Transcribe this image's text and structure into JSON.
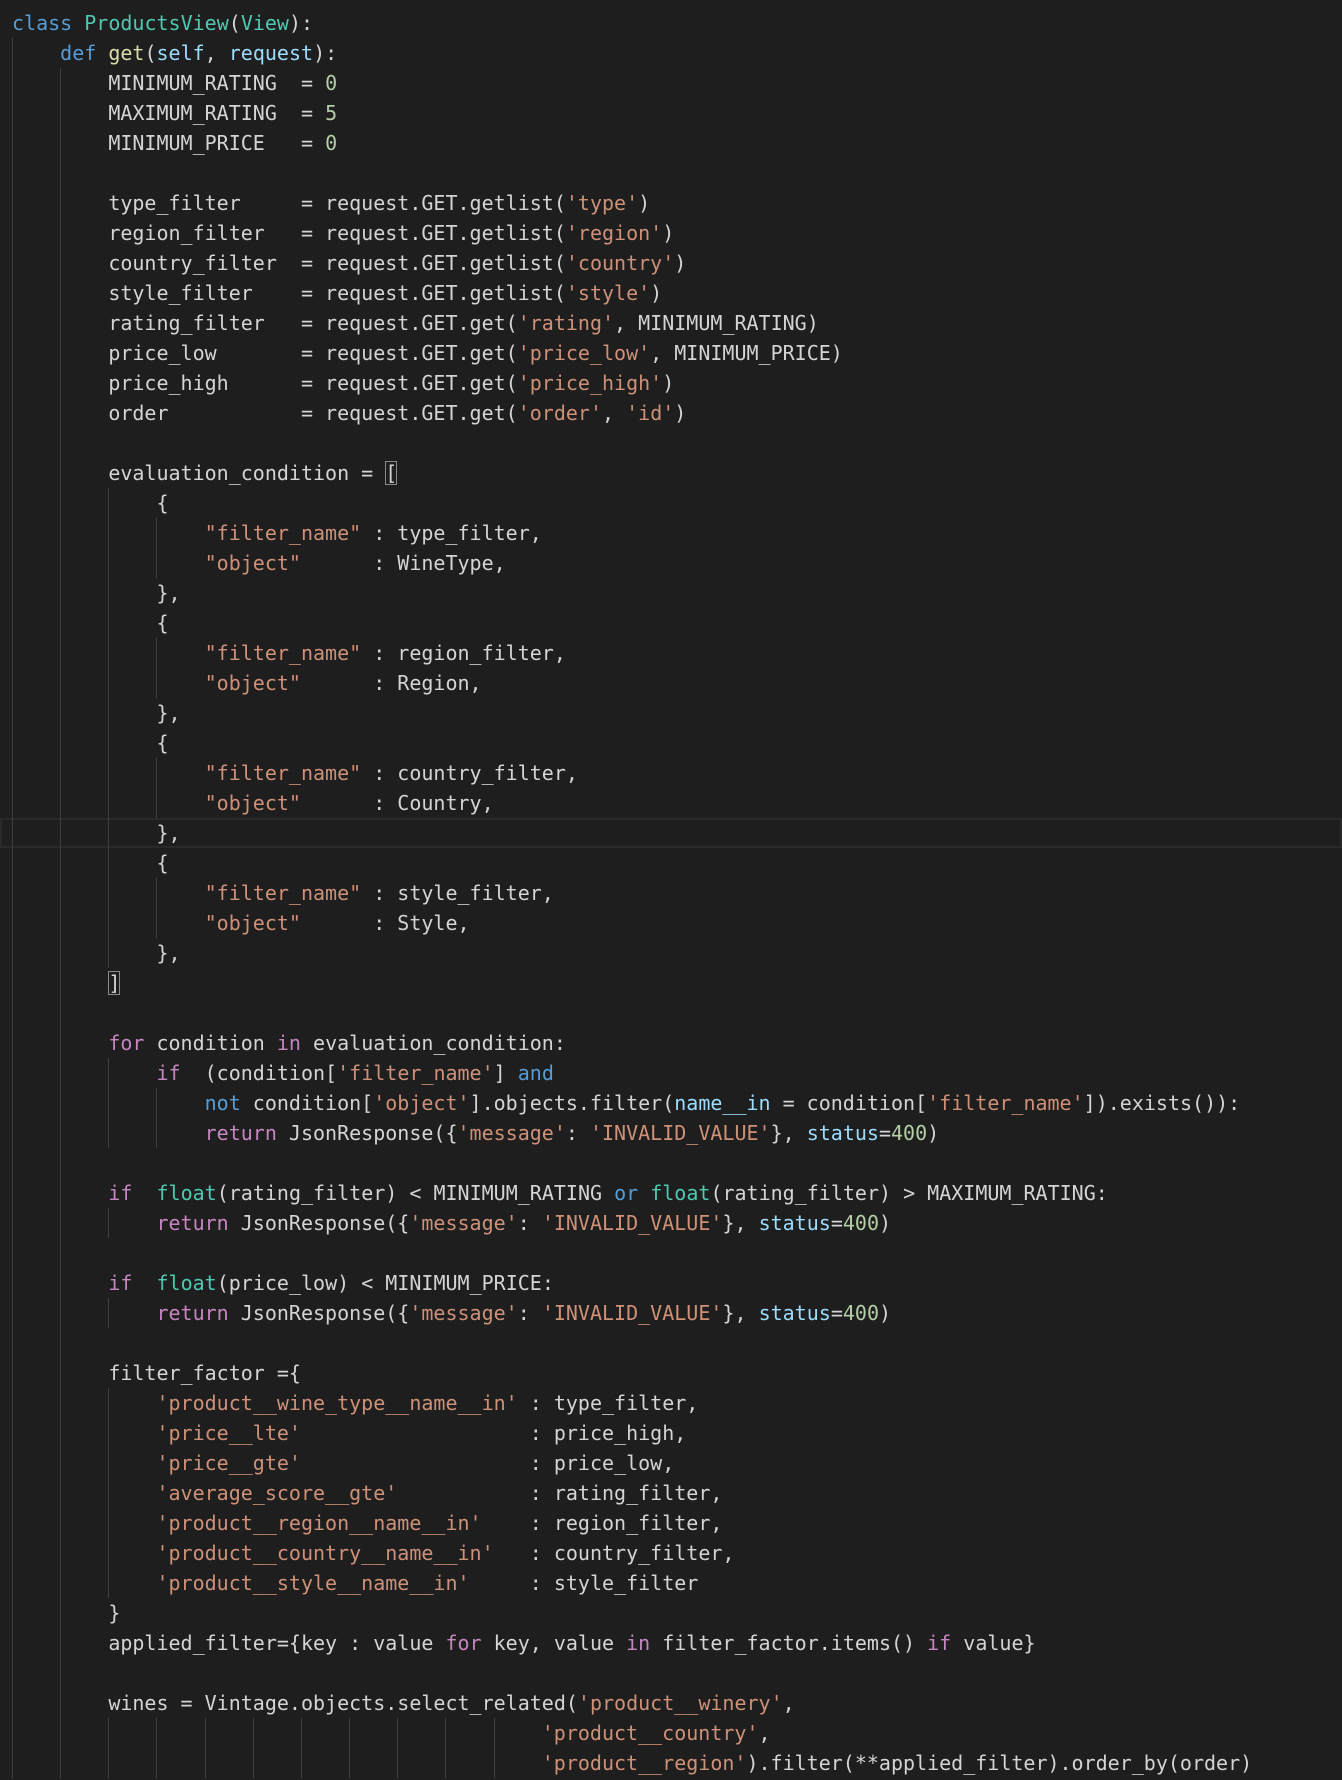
{
  "colors": {
    "background": "#1e1e1e",
    "keyword": "#569cd6",
    "control": "#c586c0",
    "class": "#4ec9b0",
    "function": "#dcdcaa",
    "parameter": "#9cdcfe",
    "string": "#ce9178",
    "number": "#b5cea8",
    "text": "#d4d4d4"
  },
  "editor": {
    "current_line": 28
  },
  "code": {
    "lines": [
      {
        "indent": 0,
        "tokens": [
          [
            "k",
            "class"
          ],
          [
            "d",
            " "
          ],
          [
            "t",
            "ProductsView"
          ],
          [
            "d",
            "("
          ],
          [
            "t",
            "View"
          ],
          [
            "d",
            "):"
          ]
        ]
      },
      {
        "indent": 4,
        "tokens": [
          [
            "k",
            "def"
          ],
          [
            "d",
            " "
          ],
          [
            "f",
            "get"
          ],
          [
            "d",
            "("
          ],
          [
            "v",
            "self"
          ],
          [
            "d",
            ", "
          ],
          [
            "v",
            "request"
          ],
          [
            "d",
            "):"
          ]
        ]
      },
      {
        "indent": 8,
        "tokens": [
          [
            "d",
            "MINIMUM_RATING  = "
          ],
          [
            "n",
            "0"
          ]
        ]
      },
      {
        "indent": 8,
        "tokens": [
          [
            "d",
            "MAXIMUM_RATING  = "
          ],
          [
            "n",
            "5"
          ]
        ]
      },
      {
        "indent": 8,
        "tokens": [
          [
            "d",
            "MINIMUM_PRICE   = "
          ],
          [
            "n",
            "0"
          ]
        ]
      },
      {
        "indent": 8,
        "tokens": []
      },
      {
        "indent": 8,
        "tokens": [
          [
            "d",
            "type_filter     = request.GET.getlist("
          ],
          [
            "s",
            "'type'"
          ],
          [
            "d",
            ")"
          ]
        ]
      },
      {
        "indent": 8,
        "tokens": [
          [
            "d",
            "region_filter   = request.GET.getlist("
          ],
          [
            "s",
            "'region'"
          ],
          [
            "d",
            ")"
          ]
        ]
      },
      {
        "indent": 8,
        "tokens": [
          [
            "d",
            "country_filter  = request.GET.getlist("
          ],
          [
            "s",
            "'country'"
          ],
          [
            "d",
            ")"
          ]
        ]
      },
      {
        "indent": 8,
        "tokens": [
          [
            "d",
            "style_filter    = request.GET.getlist("
          ],
          [
            "s",
            "'style'"
          ],
          [
            "d",
            ")"
          ]
        ]
      },
      {
        "indent": 8,
        "tokens": [
          [
            "d",
            "rating_filter   = request.GET.get("
          ],
          [
            "s",
            "'rating'"
          ],
          [
            "d",
            ", MINIMUM_RATING)"
          ]
        ]
      },
      {
        "indent": 8,
        "tokens": [
          [
            "d",
            "price_low       = request.GET.get("
          ],
          [
            "s",
            "'price_low'"
          ],
          [
            "d",
            ", MINIMUM_PRICE)"
          ]
        ]
      },
      {
        "indent": 8,
        "tokens": [
          [
            "d",
            "price_high      = request.GET.get("
          ],
          [
            "s",
            "'price_high'"
          ],
          [
            "d",
            ")"
          ]
        ]
      },
      {
        "indent": 8,
        "tokens": [
          [
            "d",
            "order           = request.GET.get("
          ],
          [
            "s",
            "'order'"
          ],
          [
            "d",
            ", "
          ],
          [
            "s",
            "'id'"
          ],
          [
            "d",
            ")"
          ]
        ]
      },
      {
        "indent": 8,
        "tokens": []
      },
      {
        "indent": 8,
        "tokens": [
          [
            "d",
            "evaluation_condition = "
          ],
          [
            "b",
            "["
          ]
        ]
      },
      {
        "indent": 12,
        "tokens": [
          [
            "d",
            "{"
          ]
        ]
      },
      {
        "indent": 16,
        "tokens": [
          [
            "s",
            "\"filter_name\""
          ],
          [
            "d",
            " : type_filter,"
          ]
        ]
      },
      {
        "indent": 16,
        "tokens": [
          [
            "s",
            "\"object\""
          ],
          [
            "d",
            "      : WineType,"
          ]
        ]
      },
      {
        "indent": 12,
        "tokens": [
          [
            "d",
            "},"
          ]
        ]
      },
      {
        "indent": 12,
        "tokens": [
          [
            "d",
            "{"
          ]
        ]
      },
      {
        "indent": 16,
        "tokens": [
          [
            "s",
            "\"filter_name\""
          ],
          [
            "d",
            " : region_filter,"
          ]
        ]
      },
      {
        "indent": 16,
        "tokens": [
          [
            "s",
            "\"object\""
          ],
          [
            "d",
            "      : Region,"
          ]
        ]
      },
      {
        "indent": 12,
        "tokens": [
          [
            "d",
            "},"
          ]
        ]
      },
      {
        "indent": 12,
        "tokens": [
          [
            "d",
            "{"
          ]
        ]
      },
      {
        "indent": 16,
        "tokens": [
          [
            "s",
            "\"filter_name\""
          ],
          [
            "d",
            " : country_filter,"
          ]
        ]
      },
      {
        "indent": 16,
        "tokens": [
          [
            "s",
            "\"object\""
          ],
          [
            "d",
            "      : Country,"
          ]
        ]
      },
      {
        "indent": 12,
        "tokens": [
          [
            "d",
            "},"
          ]
        ]
      },
      {
        "indent": 12,
        "tokens": [
          [
            "d",
            "{"
          ]
        ]
      },
      {
        "indent": 16,
        "tokens": [
          [
            "s",
            "\"filter_name\""
          ],
          [
            "d",
            " : style_filter,"
          ]
        ]
      },
      {
        "indent": 16,
        "tokens": [
          [
            "s",
            "\"object\""
          ],
          [
            "d",
            "      : Style,"
          ]
        ]
      },
      {
        "indent": 12,
        "tokens": [
          [
            "d",
            "},"
          ]
        ]
      },
      {
        "indent": 8,
        "tokens": [
          [
            "b",
            "]"
          ]
        ]
      },
      {
        "indent": 8,
        "tokens": []
      },
      {
        "indent": 8,
        "tokens": [
          [
            "c",
            "for"
          ],
          [
            "d",
            " condition "
          ],
          [
            "c",
            "in"
          ],
          [
            "d",
            " evaluation_condition:"
          ]
        ]
      },
      {
        "indent": 12,
        "tokens": [
          [
            "c",
            "if"
          ],
          [
            "d",
            "  (condition["
          ],
          [
            "s",
            "'filter_name'"
          ],
          [
            "d",
            "] "
          ],
          [
            "k",
            "and"
          ]
        ]
      },
      {
        "indent": 16,
        "tokens": [
          [
            "k",
            "not"
          ],
          [
            "d",
            " condition["
          ],
          [
            "s",
            "'object'"
          ],
          [
            "d",
            "].objects.filter("
          ],
          [
            "v",
            "name__in"
          ],
          [
            "d",
            " = condition["
          ],
          [
            "s",
            "'filter_name'"
          ],
          [
            "d",
            "]).exists()):"
          ]
        ]
      },
      {
        "indent": 16,
        "tokens": [
          [
            "c",
            "return"
          ],
          [
            "d",
            " JsonResponse({"
          ],
          [
            "s",
            "'message'"
          ],
          [
            "d",
            ": "
          ],
          [
            "s",
            "'INVALID_VALUE'"
          ],
          [
            "d",
            "}, "
          ],
          [
            "v",
            "status"
          ],
          [
            "d",
            "="
          ],
          [
            "n",
            "400"
          ],
          [
            "d",
            ")"
          ]
        ]
      },
      {
        "indent": 8,
        "tokens": []
      },
      {
        "indent": 8,
        "tokens": [
          [
            "c",
            "if"
          ],
          [
            "d",
            "  "
          ],
          [
            "t",
            "float"
          ],
          [
            "d",
            "(rating_filter) < MINIMUM_RATING "
          ],
          [
            "k",
            "or"
          ],
          [
            "d",
            " "
          ],
          [
            "t",
            "float"
          ],
          [
            "d",
            "(rating_filter) > MAXIMUM_RATING:"
          ]
        ]
      },
      {
        "indent": 12,
        "tokens": [
          [
            "c",
            "return"
          ],
          [
            "d",
            " JsonResponse({"
          ],
          [
            "s",
            "'message'"
          ],
          [
            "d",
            ": "
          ],
          [
            "s",
            "'INVALID_VALUE'"
          ],
          [
            "d",
            "}, "
          ],
          [
            "v",
            "status"
          ],
          [
            "d",
            "="
          ],
          [
            "n",
            "400"
          ],
          [
            "d",
            ")"
          ]
        ]
      },
      {
        "indent": 8,
        "tokens": []
      },
      {
        "indent": 8,
        "tokens": [
          [
            "c",
            "if"
          ],
          [
            "d",
            "  "
          ],
          [
            "t",
            "float"
          ],
          [
            "d",
            "(price_low) < MINIMUM_PRICE:"
          ]
        ]
      },
      {
        "indent": 12,
        "tokens": [
          [
            "c",
            "return"
          ],
          [
            "d",
            " JsonResponse({"
          ],
          [
            "s",
            "'message'"
          ],
          [
            "d",
            ": "
          ],
          [
            "s",
            "'INVALID_VALUE'"
          ],
          [
            "d",
            "}, "
          ],
          [
            "v",
            "status"
          ],
          [
            "d",
            "="
          ],
          [
            "n",
            "400"
          ],
          [
            "d",
            ")"
          ]
        ]
      },
      {
        "indent": 8,
        "tokens": []
      },
      {
        "indent": 8,
        "tokens": [
          [
            "d",
            "filter_factor ={"
          ]
        ]
      },
      {
        "indent": 12,
        "tokens": [
          [
            "s",
            "'product__wine_type__name__in'"
          ],
          [
            "d",
            " : type_filter,"
          ]
        ]
      },
      {
        "indent": 12,
        "tokens": [
          [
            "s",
            "'price__lte'"
          ],
          [
            "d",
            "                   : price_high,"
          ]
        ]
      },
      {
        "indent": 12,
        "tokens": [
          [
            "s",
            "'price__gte'"
          ],
          [
            "d",
            "                   : price_low,"
          ]
        ]
      },
      {
        "indent": 12,
        "tokens": [
          [
            "s",
            "'average_score__gte'"
          ],
          [
            "d",
            "           : rating_filter,"
          ]
        ]
      },
      {
        "indent": 12,
        "tokens": [
          [
            "s",
            "'product__region__name__in'"
          ],
          [
            "d",
            "    : region_filter,"
          ]
        ]
      },
      {
        "indent": 12,
        "tokens": [
          [
            "s",
            "'product__country__name__in'"
          ],
          [
            "d",
            "   : country_filter,"
          ]
        ]
      },
      {
        "indent": 12,
        "tokens": [
          [
            "s",
            "'product__style__name__in'"
          ],
          [
            "d",
            "     : style_filter"
          ]
        ]
      },
      {
        "indent": 8,
        "tokens": [
          [
            "d",
            "}"
          ]
        ]
      },
      {
        "indent": 8,
        "tokens": [
          [
            "d",
            "applied_filter={key : value "
          ],
          [
            "c",
            "for"
          ],
          [
            "d",
            " key, value "
          ],
          [
            "c",
            "in"
          ],
          [
            "d",
            " filter_factor.items() "
          ],
          [
            "c",
            "if"
          ],
          [
            "d",
            " value}"
          ]
        ]
      },
      {
        "indent": 8,
        "tokens": []
      },
      {
        "indent": 8,
        "tokens": [
          [
            "d",
            "wines = Vintage.objects.select_related("
          ],
          [
            "s",
            "'product__winery'"
          ],
          [
            "d",
            ","
          ]
        ]
      },
      {
        "indent": 44,
        "tokens": [
          [
            "s",
            "'product__country'"
          ],
          [
            "d",
            ","
          ]
        ]
      },
      {
        "indent": 44,
        "tokens": [
          [
            "s",
            "'product__region'"
          ],
          [
            "d",
            ").filter(**applied_filter).order_by(order)"
          ]
        ]
      }
    ]
  }
}
